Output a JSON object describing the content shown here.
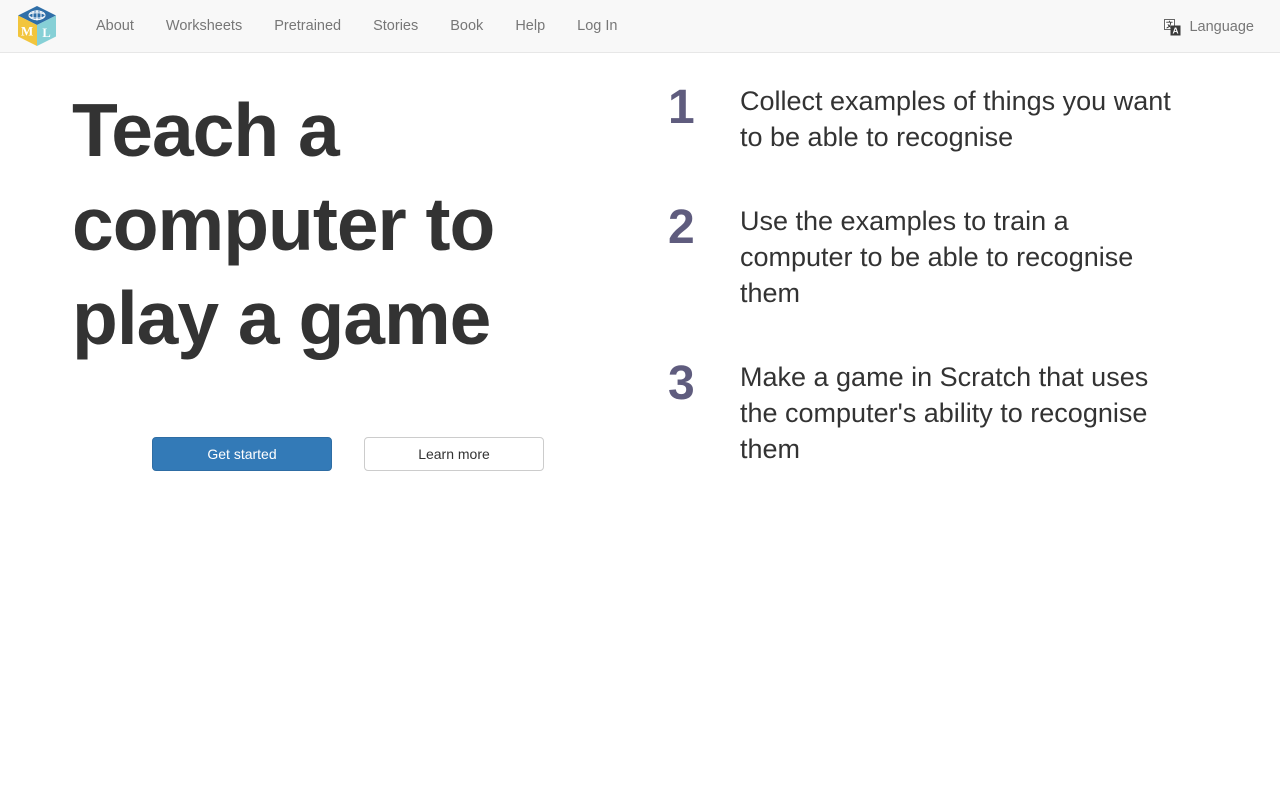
{
  "navbar": {
    "brand": {
      "icon": "ml-cube-logo",
      "faces": {
        "top_letter": "",
        "left_letter": "M",
        "right_letter": "L"
      },
      "colors": {
        "top": "#2e6da4",
        "left": "#f0c33c",
        "right": "#7fcfd6"
      }
    },
    "links": [
      {
        "label": "About"
      },
      {
        "label": "Worksheets"
      },
      {
        "label": "Pretrained"
      },
      {
        "label": "Stories"
      },
      {
        "label": "Book"
      },
      {
        "label": "Help"
      },
      {
        "label": "Log In"
      }
    ],
    "language": {
      "label": "Language",
      "icon": "translate-icon"
    }
  },
  "hero": {
    "headline": "Teach a computer to play a game",
    "primary_button": "Get started",
    "secondary_button": "Learn more"
  },
  "steps": [
    {
      "number": "1",
      "text": "Collect examples of things you want to be able to recognise"
    },
    {
      "number": "2",
      "text": "Use the examples to train a computer to be able to recognise them"
    },
    {
      "number": "3",
      "text": "Make a game in Scratch that uses the computer's ability to recognise them"
    }
  ],
  "colors": {
    "primary": "#337ab7",
    "step_number": "#5f5c7e",
    "navbar_bg": "#f8f8f8",
    "text": "#333333",
    "nav_link": "#777777"
  }
}
